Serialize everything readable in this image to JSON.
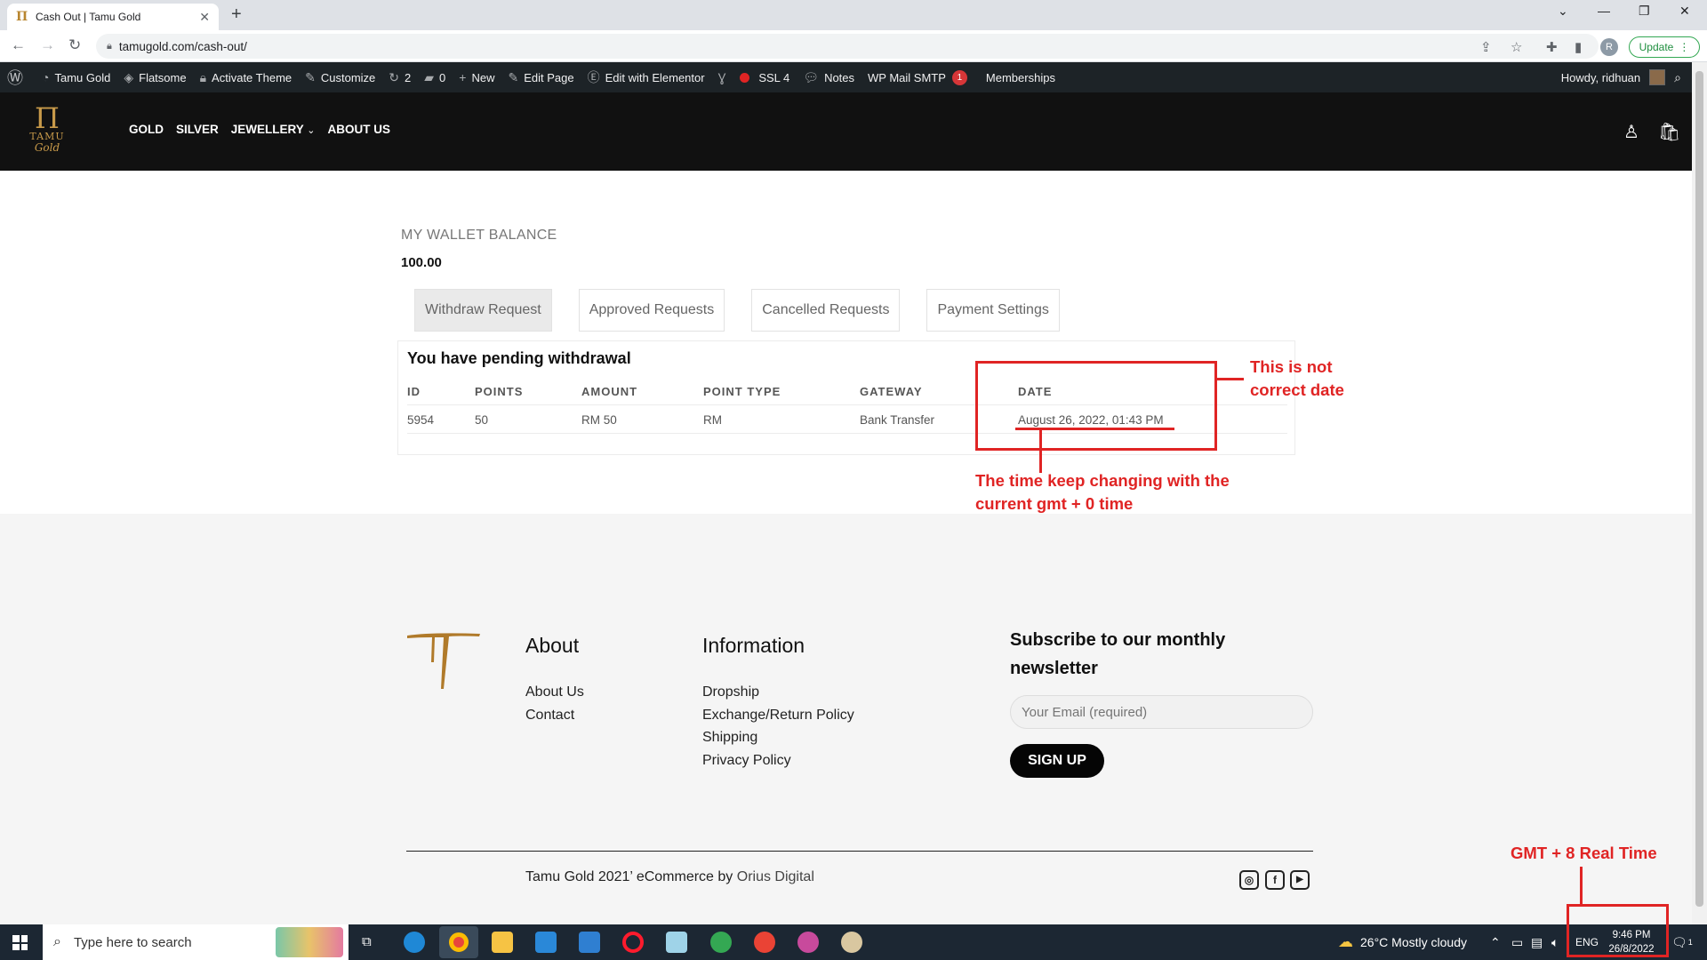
{
  "browser": {
    "tab_title": "Cash Out | Tamu Gold",
    "url": "tamugold.com/cash-out/",
    "profile_initial": "R",
    "update_label": "Update"
  },
  "admin_bar": {
    "items": [
      {
        "icon": "wordpress-icon",
        "label": ""
      },
      {
        "icon": "dashboard-icon",
        "label": "Tamu Gold"
      },
      {
        "icon": "flatsome-icon",
        "label": "Flatsome"
      },
      {
        "icon": "lock-icon",
        "label": "Activate Theme"
      },
      {
        "icon": "brush-icon",
        "label": "Customize"
      },
      {
        "icon": "refresh-icon",
        "label": "2"
      },
      {
        "icon": "comment-icon",
        "label": "0"
      },
      {
        "icon": "plus-icon",
        "label": "New"
      },
      {
        "icon": "pencil-icon",
        "label": "Edit Page"
      },
      {
        "icon": "elementor-icon",
        "label": "Edit with Elementor"
      },
      {
        "icon": "yoast-icon",
        "label": ""
      },
      {
        "icon": "ssl-icon",
        "label": "SSL 4"
      },
      {
        "icon": "notes-icon",
        "label": "Notes"
      },
      {
        "icon": "mail-icon",
        "label": "WP Mail SMTP",
        "badge": "1"
      },
      {
        "icon": "",
        "label": "Memberships"
      }
    ],
    "howdy": "Howdy, ridhuan"
  },
  "site": {
    "logo_word": "TAMU",
    "logo_script": "Gold",
    "nav": [
      "GOLD",
      "SILVER",
      "JEWELLERY",
      "ABOUT US"
    ]
  },
  "wallet": {
    "title": "MY WALLET BALANCE",
    "amount": "100.00",
    "tabs": [
      "Withdraw Request",
      "Approved Requests",
      "Cancelled Requests",
      "Payment Settings"
    ],
    "active_tab": "Withdraw Request"
  },
  "pending": {
    "heading": "You have pending withdrawal",
    "columns": [
      "ID",
      "POINTS",
      "AMOUNT",
      "POINT TYPE",
      "GATEWAY",
      "DATE"
    ],
    "rows": [
      [
        "5954",
        "50",
        "RM 50",
        "RM",
        "Bank Transfer",
        "August 26, 2022, 01:43 PM"
      ]
    ]
  },
  "annotations": {
    "not_correct": "This is not correct date",
    "time_changing": "The time keep changing with the current gmt + 0 time",
    "gmt_real": "GMT + 8 Real Time",
    "color": "#e02424"
  },
  "footer": {
    "about_title": "About",
    "about_links": [
      "About Us",
      "Contact"
    ],
    "info_title": "Information",
    "info_links": [
      "Dropship",
      "Exchange/Return Policy",
      "Shipping",
      "Privacy Policy"
    ],
    "subscribe_title": "Subscribe to our monthly newsletter",
    "email_placeholder": "Your Email (required)",
    "signup_label": "SIGN UP",
    "copyright_text": "Tamu Gold 2021’ eCommerce by",
    "copyright_link": "Orius Digital",
    "social": [
      "instagram-icon",
      "facebook-icon",
      "youtube-icon"
    ]
  },
  "taskbar": {
    "search_placeholder": "Type here to search",
    "weather": "26°C  Mostly cloudy",
    "lang": "ENG",
    "time": "9:46 PM",
    "date": "26/8/2022",
    "notifications": "1"
  }
}
